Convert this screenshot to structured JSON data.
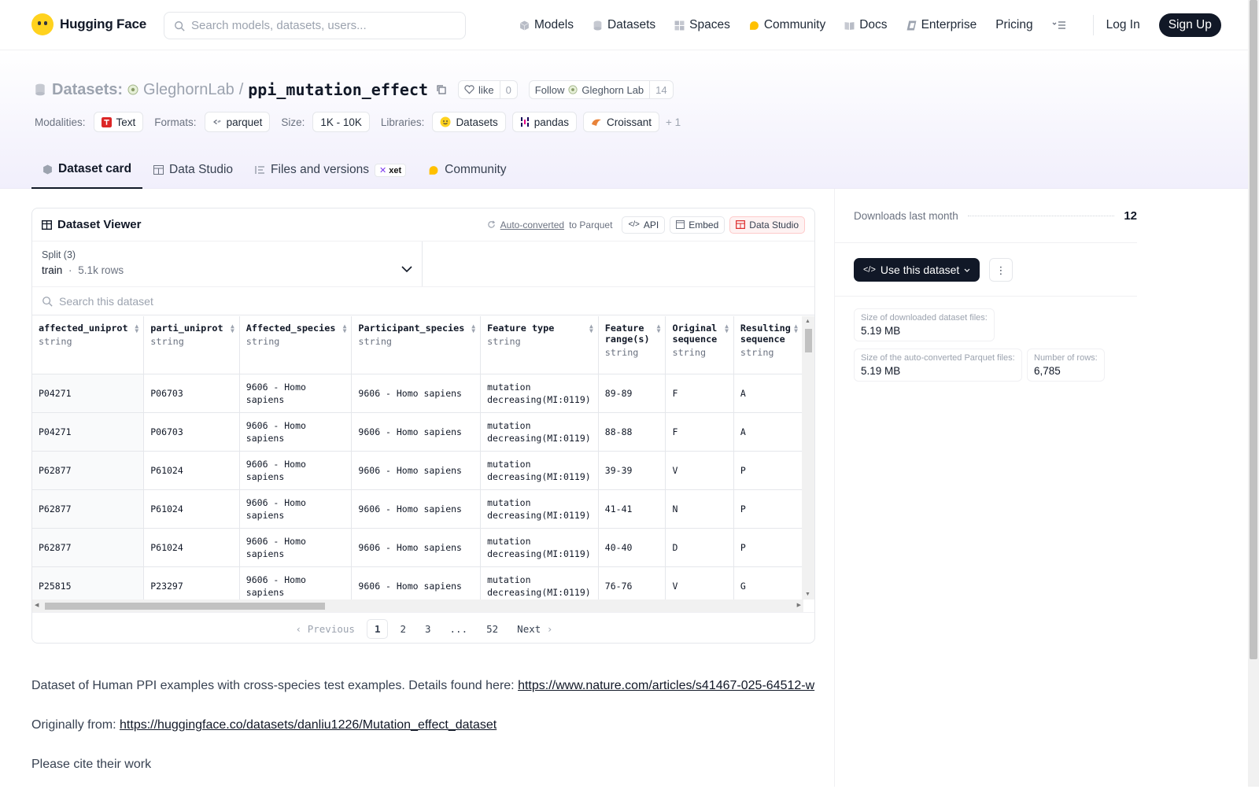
{
  "nav": {
    "brand": "Hugging Face",
    "search_placeholder": "Search models, datasets, users...",
    "links": {
      "models": "Models",
      "datasets": "Datasets",
      "spaces": "Spaces",
      "community": "Community",
      "docs": "Docs",
      "enterprise": "Enterprise",
      "pricing": "Pricing"
    },
    "login": "Log In",
    "signup": "Sign Up"
  },
  "header": {
    "section": "Datasets:",
    "org": "GleghornLab",
    "separator": "/",
    "name": "ppi_mutation_effect",
    "like_label": "like",
    "like_count": "0",
    "follow_label": "Follow",
    "follow_org": "Gleghorn Lab",
    "follow_count": "14",
    "modalities_label": "Modalities:",
    "modality": "Text",
    "formats_label": "Formats:",
    "format": "parquet",
    "size_label": "Size:",
    "size": "1K - 10K",
    "libraries_label": "Libraries:",
    "libraries": {
      "a": "Datasets",
      "b": "pandas",
      "c": "Croissant"
    },
    "libraries_more": "+ 1"
  },
  "tabs": {
    "card": "Dataset card",
    "studio": "Data Studio",
    "files": "Files and versions",
    "files_badge": "xet",
    "community": "Community"
  },
  "viewer": {
    "title": "Dataset Viewer",
    "autoconv_link": "Auto-converted",
    "autoconv_rest": "to Parquet",
    "api": "API",
    "embed": "Embed",
    "studio": "Data Studio",
    "split_label": "Split (3)",
    "split_name": "train",
    "split_dot": "·",
    "split_rows": "5.1k rows",
    "search_placeholder": "Search this dataset",
    "columns": [
      {
        "name": "affected_uniprot",
        "type": "string"
      },
      {
        "name": "parti_uniprot",
        "type": "string"
      },
      {
        "name": "Affected_species",
        "type": "string"
      },
      {
        "name": "Participant_species",
        "type": "string"
      },
      {
        "name": "Feature type",
        "type": "string"
      },
      {
        "name": "Feature range(s)",
        "type": "string"
      },
      {
        "name": "Original sequence",
        "type": "string"
      },
      {
        "name": "Resulting sequence",
        "type": "string"
      }
    ],
    "rows": [
      [
        "P04271",
        "P06703",
        "9606 - Homo sapiens",
        "9606 - Homo sapiens",
        "mutation decreasing(MI:0119)",
        "89-89",
        "F",
        "A"
      ],
      [
        "P04271",
        "P06703",
        "9606 - Homo sapiens",
        "9606 - Homo sapiens",
        "mutation decreasing(MI:0119)",
        "88-88",
        "F",
        "A"
      ],
      [
        "P62877",
        "P61024",
        "9606 - Homo sapiens",
        "9606 - Homo sapiens",
        "mutation decreasing(MI:0119)",
        "39-39",
        "V",
        "P"
      ],
      [
        "P62877",
        "P61024",
        "9606 - Homo sapiens",
        "9606 - Homo sapiens",
        "mutation decreasing(MI:0119)",
        "41-41",
        "N",
        "P"
      ],
      [
        "P62877",
        "P61024",
        "9606 - Homo sapiens",
        "9606 - Homo sapiens",
        "mutation decreasing(MI:0119)",
        "40-40",
        "D",
        "P"
      ],
      [
        "P25815",
        "P23297",
        "9606 - Homo sapiens",
        "9606 - Homo sapiens",
        "mutation decreasing(MI:0119)",
        "76-76",
        "V",
        "G"
      ]
    ],
    "pager": {
      "prev": "Previous",
      "p1": "1",
      "p2": "2",
      "p3": "3",
      "ellipsis": "...",
      "last": "52",
      "next": "Next"
    }
  },
  "card": {
    "p1_text": "Dataset of Human PPI examples with cross-species test examples. Details found here: ",
    "p1_link": "https://www.nature.com/articles/s41467-025-64512-w",
    "p2_text": "Originally from: ",
    "p2_link": "https://huggingface.co/datasets/danliu1226/Mutation_effect_dataset",
    "p3_text": "Please cite their work"
  },
  "sidebar": {
    "downloads_label": "Downloads last month",
    "downloads_value": "12",
    "use_button": "Use this dataset",
    "size_dl_label": "Size of downloaded dataset files:",
    "size_dl_value": "5.19 MB",
    "size_pq_label": "Size of the auto-converted Parquet files:",
    "size_pq_value": "5.19 MB",
    "rows_label": "Number of rows:",
    "rows_value": "6,785"
  }
}
